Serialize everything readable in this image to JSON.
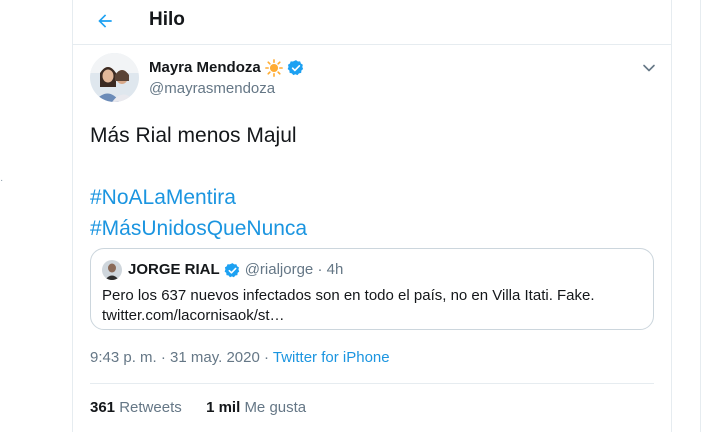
{
  "header": {
    "title": "Hilo",
    "back_icon": "arrow-left-icon",
    "accent": "#1da1f2"
  },
  "tweet": {
    "author_name": "Mayra Mendoza",
    "author_handle": "@mayrasmendoza",
    "author_emoji": "☀️",
    "verified_icon": "verified-badge-icon",
    "menu_icon": "chevron-down-icon",
    "text_line": "Más Rial menos Majul",
    "hashtags": [
      "#NoALaMentira",
      "#MásUnidosQueNunca"
    ],
    "hashtag_color": "#1b95e0",
    "timestamp": "9:43 p. m. · 31 may. 2020 · ",
    "source": "Twitter for iPhone",
    "retweets_count": "361",
    "retweets_label": "Retweets",
    "likes_count": "1 mil",
    "likes_label": "Me gusta"
  },
  "quoted_tweet": {
    "author_name": "JORGE RIAL",
    "meta": "@rialjorge · 4h",
    "verified_icon": "verified-badge-icon",
    "body_line1": "Pero los 637 nuevos infectados son en todo el país, no en Villa Itati. Fake.",
    "body_line2": "twitter.com/lacornisaok/st…"
  }
}
